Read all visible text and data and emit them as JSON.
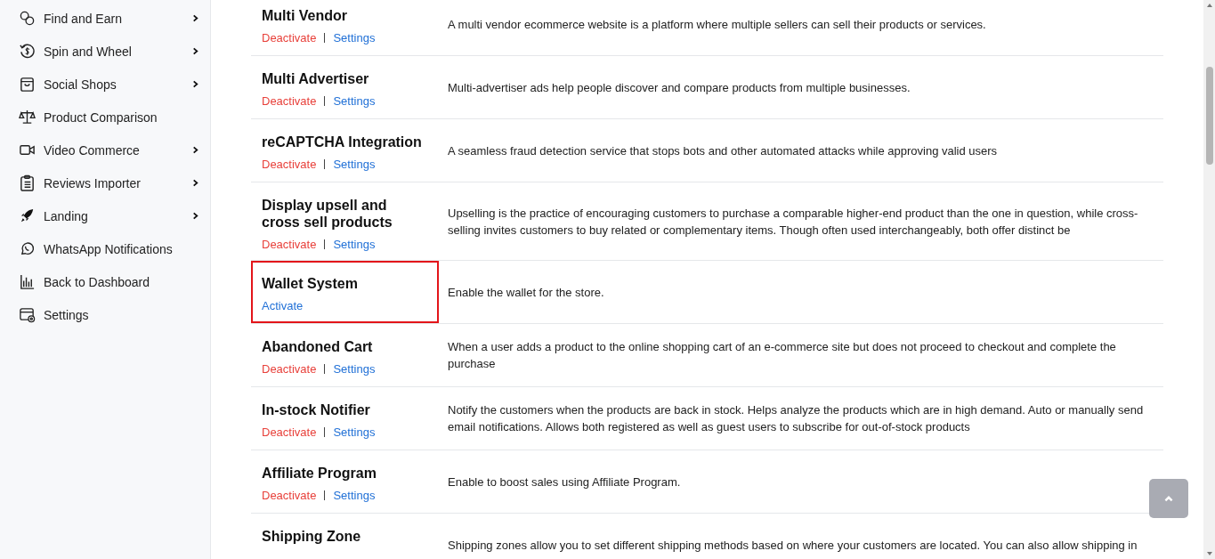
{
  "sidebar": {
    "items": [
      {
        "label": "Find and Earn",
        "expandable": true
      },
      {
        "label": "Spin and Wheel",
        "expandable": true
      },
      {
        "label": "Social Shops",
        "expandable": true
      },
      {
        "label": "Product Comparison",
        "expandable": false
      },
      {
        "label": "Video Commerce",
        "expandable": true
      },
      {
        "label": "Reviews Importer",
        "expandable": true
      },
      {
        "label": "Landing",
        "expandable": true
      },
      {
        "label": "WhatsApp Notifications",
        "expandable": false
      },
      {
        "label": "Back to Dashboard",
        "expandable": false
      },
      {
        "label": "Settings",
        "expandable": false
      }
    ]
  },
  "modules": [
    {
      "name": "Multi Vendor",
      "highlighted": false,
      "actions": [
        {
          "label": "Deactivate",
          "kind": "deactivate"
        },
        {
          "label": "Settings",
          "kind": "settings"
        }
      ],
      "description": "A multi vendor ecommerce website is a platform where multiple sellers can sell their products or services."
    },
    {
      "name": "Multi Advertiser",
      "highlighted": false,
      "actions": [
        {
          "label": "Deactivate",
          "kind": "deactivate"
        },
        {
          "label": "Settings",
          "kind": "settings"
        }
      ],
      "description": "Multi-advertiser ads help people discover and compare products from multiple businesses."
    },
    {
      "name": "reCAPTCHA Integration",
      "highlighted": false,
      "actions": [
        {
          "label": "Deactivate",
          "kind": "deactivate"
        },
        {
          "label": "Settings",
          "kind": "settings"
        }
      ],
      "description": "A seamless fraud detection service that stops bots and other automated attacks while approving valid users"
    },
    {
      "name": "Display upsell and cross sell products",
      "highlighted": false,
      "actions": [
        {
          "label": "Deactivate",
          "kind": "deactivate"
        },
        {
          "label": "Settings",
          "kind": "settings"
        }
      ],
      "description": "Upselling is the practice of encouraging customers to purchase a comparable higher-end product than the one in question, while cross-selling invites customers to buy related or complementary items. Though often used interchangeably, both offer distinct be"
    },
    {
      "name": "Wallet System",
      "highlighted": true,
      "actions": [
        {
          "label": "Activate",
          "kind": "activate"
        }
      ],
      "description": "Enable the wallet for the store."
    },
    {
      "name": "Abandoned Cart",
      "highlighted": false,
      "actions": [
        {
          "label": "Deactivate",
          "kind": "deactivate"
        },
        {
          "label": "Settings",
          "kind": "settings"
        }
      ],
      "description": "When a user adds a product to the online shopping cart of an e-commerce site but does not proceed to checkout and complete the purchase"
    },
    {
      "name": "In-stock Notifier",
      "highlighted": false,
      "actions": [
        {
          "label": "Deactivate",
          "kind": "deactivate"
        },
        {
          "label": "Settings",
          "kind": "settings"
        }
      ],
      "description": "Notify the customers when the products are back in stock. Helps analyze the products which are in high demand. Auto or manually send email notifications. Allows both registered as well as guest users to subscribe for out-of-stock products"
    },
    {
      "name": "Affiliate Program",
      "highlighted": false,
      "actions": [
        {
          "label": "Deactivate",
          "kind": "deactivate"
        },
        {
          "label": "Settings",
          "kind": "settings"
        }
      ],
      "description": "Enable to boost sales using Affiliate Program."
    },
    {
      "name": "Shipping Zone",
      "highlighted": false,
      "description": "Shipping zones allow you to set different shipping methods based on where your customers are located. You can also allow shipping in"
    }
  ]
}
